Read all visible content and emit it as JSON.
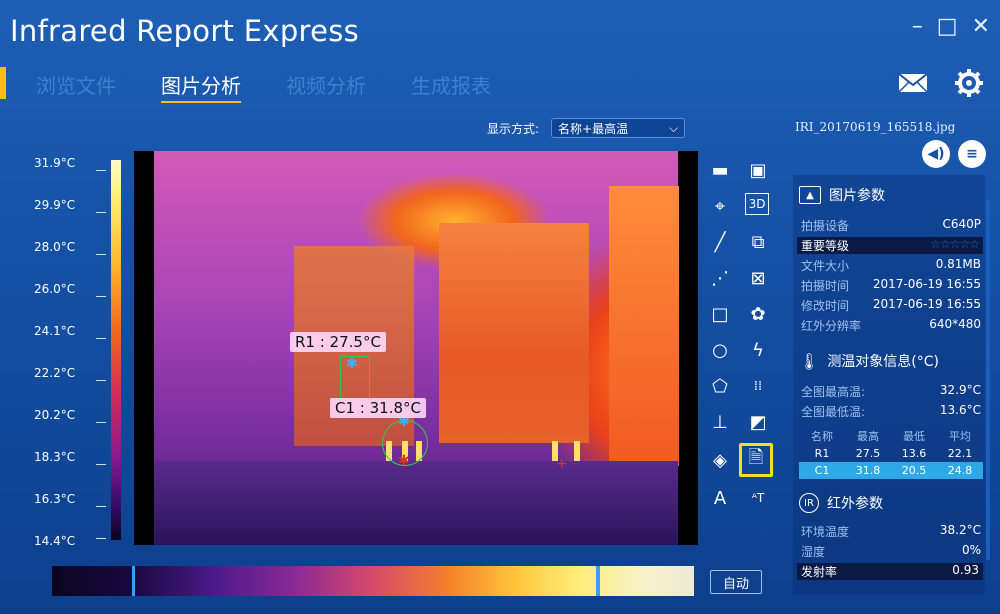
{
  "app": {
    "title": "Infrared Report Express"
  },
  "window_controls": {
    "minimize": "–",
    "maximize": "□",
    "close": "✕"
  },
  "nav": {
    "tabs": [
      "浏览文件",
      "图片分析",
      "视频分析",
      "生成报表"
    ],
    "active_index": 1
  },
  "display": {
    "label": "显示方式:",
    "value": "名称+最高温"
  },
  "file": {
    "name": "IRI_20170619_165518.jpg"
  },
  "scale": {
    "labels": [
      "31.9°C",
      "29.9°C",
      "28.0°C",
      "26.0°C",
      "24.1°C",
      "22.2°C",
      "20.2°C",
      "18.3°C",
      "16.3°C",
      "14.4°C"
    ]
  },
  "rois": {
    "r1": {
      "label": "R1 : 27.5°C"
    },
    "c1": {
      "label": "C1 : 31.8°C"
    }
  },
  "auto_button": "自动",
  "panel": {
    "image_params": {
      "title": "图片参数",
      "rows": [
        {
          "k": "拍摄设备",
          "v": "C640P"
        },
        {
          "k": "重要等级",
          "v": "☆☆☆☆☆"
        },
        {
          "k": "文件大小",
          "v": "0.81MB"
        },
        {
          "k": "拍摄时间",
          "v": "2017-06-19 16:55"
        },
        {
          "k": "修改时间",
          "v": "2017-06-19 16:55"
        },
        {
          "k": "红外分辨率",
          "v": "640*480"
        }
      ]
    },
    "measure": {
      "title": "测温对象信息(°C)",
      "rows": [
        {
          "k": "全图最高温:",
          "v": "32.9°C"
        },
        {
          "k": "全图最低温:",
          "v": "13.6°C"
        }
      ],
      "table_header": [
        "名称",
        "最高",
        "最低",
        "平均"
      ],
      "table_rows": [
        [
          "R1",
          "27.5",
          "13.6",
          "22.1"
        ],
        [
          "C1",
          "31.8",
          "20.5",
          "24.8"
        ]
      ]
    },
    "ir_params": {
      "title": "红外参数",
      "rows": [
        {
          "k": "环境温度",
          "v": "38.2°C"
        },
        {
          "k": "湿度",
          "v": "0%"
        },
        {
          "k": "发射率",
          "v": "0.93"
        }
      ]
    }
  },
  "colors": {
    "accent": "#f4c20d",
    "highlight": "#f4e01b",
    "selected_row": "#2fa8e8"
  }
}
